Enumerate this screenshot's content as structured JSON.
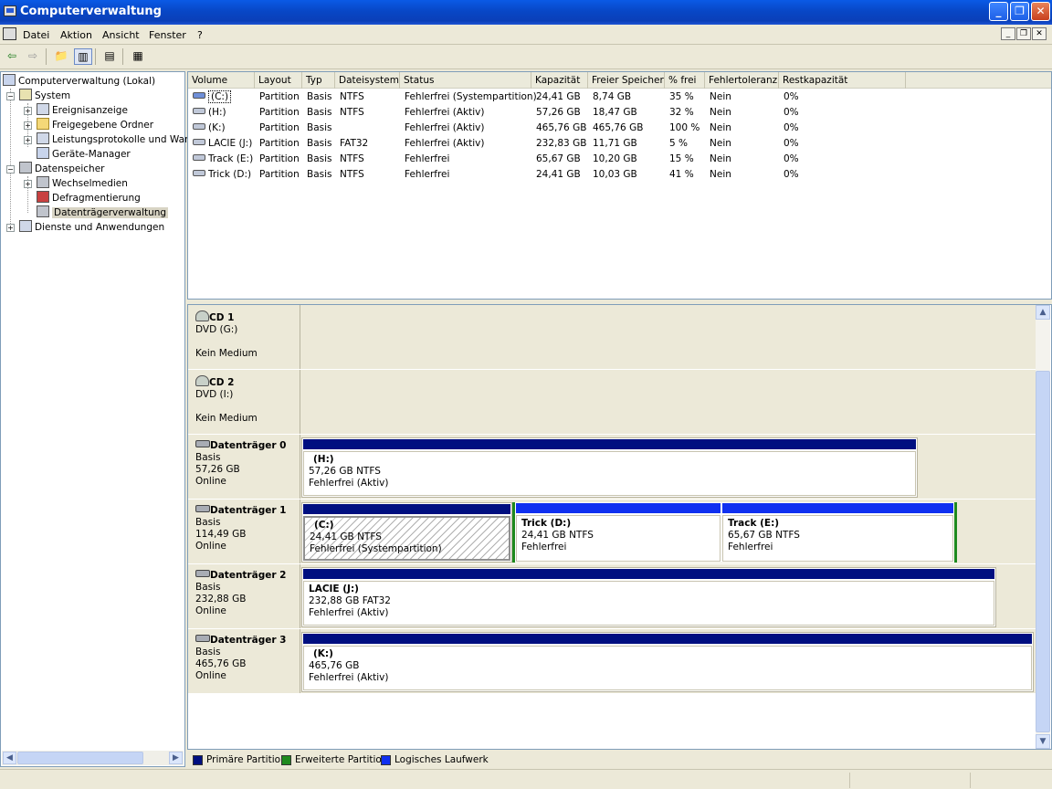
{
  "window": {
    "title": "Computerverwaltung"
  },
  "menu": {
    "items": [
      "Datei",
      "Aktion",
      "Ansicht",
      "Fenster",
      "?"
    ]
  },
  "tree": {
    "root": "Computerverwaltung (Lokal)",
    "system": "System",
    "ereignisanzeige": "Ereignisanzeige",
    "freigegebene": "Freigegebene Ordner",
    "leistung": "Leistungsprotokolle und Warn",
    "geraete": "Geräte-Manager",
    "datenspeicher": "Datenspeicher",
    "wechselmedien": "Wechselmedien",
    "defrag": "Defragmentierung",
    "datentraeger": "Datenträgerverwaltung",
    "dienste": "Dienste und Anwendungen"
  },
  "list": {
    "columns": [
      "Volume",
      "Layout",
      "Typ",
      "Dateisystem",
      "Status",
      "Kapazität",
      "Freier Speicher",
      "% frei",
      "Fehlertoleranz",
      "Restkapazität"
    ],
    "rows": [
      [
        "(C:)",
        "Partition",
        "Basis",
        "NTFS",
        "Fehlerfrei (Systempartition)",
        "24,41 GB",
        "8,74 GB",
        "35 %",
        "Nein",
        "0%"
      ],
      [
        "(H:)",
        "Partition",
        "Basis",
        "NTFS",
        "Fehlerfrei (Aktiv)",
        "57,26 GB",
        "18,47 GB",
        "32 %",
        "Nein",
        "0%"
      ],
      [
        "(K:)",
        "Partition",
        "Basis",
        "",
        "Fehlerfrei (Aktiv)",
        "465,76 GB",
        "465,76 GB",
        "100 %",
        "Nein",
        "0%"
      ],
      [
        "LACIE (J:)",
        "Partition",
        "Basis",
        "FAT32",
        "Fehlerfrei (Aktiv)",
        "232,83 GB",
        "11,71 GB",
        "5 %",
        "Nein",
        "0%"
      ],
      [
        "Track (E:)",
        "Partition",
        "Basis",
        "NTFS",
        "Fehlerfrei",
        "65,67 GB",
        "10,20 GB",
        "15 %",
        "Nein",
        "0%"
      ],
      [
        "Trick (D:)",
        "Partition",
        "Basis",
        "NTFS",
        "Fehlerfrei",
        "24,41 GB",
        "10,03 GB",
        "41 %",
        "Nein",
        "0%"
      ]
    ]
  },
  "disks": {
    "cd1": {
      "name": "CD 1",
      "l1": "DVD (G:)",
      "l2": "Kein Medium"
    },
    "cd2": {
      "name": "CD 2",
      "l1": "DVD (I:)",
      "l2": "Kein Medium"
    },
    "d0": {
      "name": "Datenträger 0",
      "type": "Basis",
      "size": "57,26 GB",
      "state": "Online",
      "p1": {
        "name": "(H:)",
        "size": "57,26 GB NTFS",
        "status": "Fehlerfrei (Aktiv)"
      }
    },
    "d1": {
      "name": "Datenträger 1",
      "type": "Basis",
      "size": "114,49 GB",
      "state": "Online",
      "p1": {
        "name": "(C:)",
        "size": "24,41 GB NTFS",
        "status": "Fehlerfrei (Systempartition)"
      },
      "p2": {
        "name": "Trick  (D:)",
        "size": "24,41 GB NTFS",
        "status": "Fehlerfrei"
      },
      "p3": {
        "name": "Track  (E:)",
        "size": "65,67 GB NTFS",
        "status": "Fehlerfrei"
      }
    },
    "d2": {
      "name": "Datenträger 2",
      "type": "Basis",
      "size": "232,88 GB",
      "state": "Online",
      "p1": {
        "name": "LACIE  (J:)",
        "size": "232,88 GB FAT32",
        "status": "Fehlerfrei (Aktiv)"
      }
    },
    "d3": {
      "name": "Datenträger 3",
      "type": "Basis",
      "size": "465,76 GB",
      "state": "Online",
      "p1": {
        "name": "(K:)",
        "size": "465,76 GB",
        "status": "Fehlerfrei (Aktiv)"
      }
    }
  },
  "legend": {
    "primary": "Primäre Partition",
    "extended": "Erweiterte Partition",
    "logical": "Logisches Laufwerk"
  },
  "colors": {
    "primary": "#000f80",
    "extended": "#1e8a1e",
    "logical": "#1030f0"
  }
}
